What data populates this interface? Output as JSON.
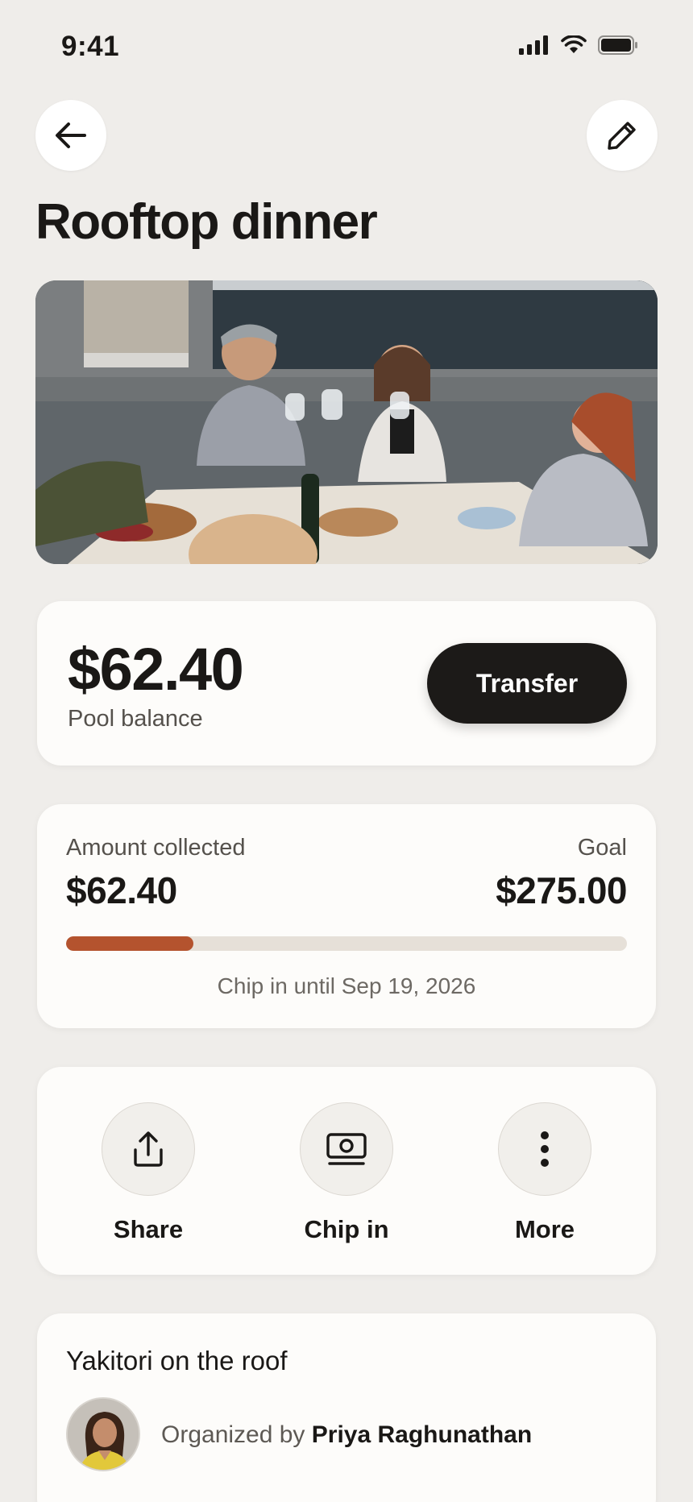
{
  "status_bar": {
    "time": "9:41"
  },
  "header": {
    "title": "Rooftop dinner"
  },
  "balance": {
    "amount": "$62.40",
    "label": "Pool balance",
    "transfer_label": "Transfer"
  },
  "progress": {
    "collected_label": "Amount collected",
    "collected_amount": "$62.40",
    "goal_label": "Goal",
    "goal_amount": "$275.00",
    "fraction": 0.227,
    "deadline": "Chip in until Sep 19, 2026"
  },
  "actions": [
    {
      "label": "Share",
      "icon": "share-icon"
    },
    {
      "label": "Chip in",
      "icon": "cash-icon"
    },
    {
      "label": "More",
      "icon": "more-vertical-icon"
    }
  ],
  "event": {
    "name": "Yakitori on the roof",
    "organized_prefix": "Organized by",
    "organizer_name": "Priya Raghunathan"
  },
  "colors": {
    "accent": "#b4532e",
    "background": "#efedea",
    "dark_button": "#1c1a18"
  }
}
